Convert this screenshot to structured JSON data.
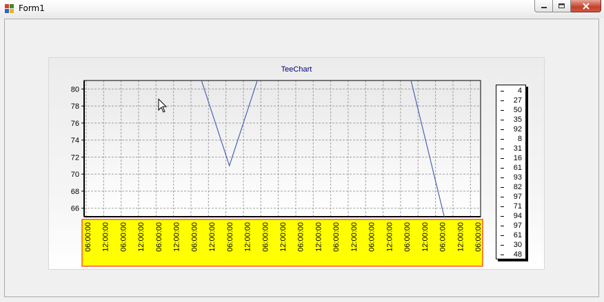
{
  "window": {
    "title": "Form1",
    "icon": "winforms-app-icon",
    "buttons": [
      "minimize-icon",
      "maximize-icon",
      "close-icon"
    ]
  },
  "colors": {
    "series_line": "#4a63b5",
    "x_label_background": "#ffff00",
    "x_label_border": "#ff0000",
    "title_color": "#000080"
  },
  "chart_data": {
    "type": "line",
    "title": "TeeChart",
    "ylim": [
      65,
      81
    ],
    "yticks": [
      66,
      68,
      70,
      72,
      74,
      76,
      78,
      80
    ],
    "x_tick_labels": [
      "06:00:00",
      "12:00:00",
      "06:00:00",
      "12:00:00",
      "06:00:00",
      "12:00:00",
      "06:00:00",
      "12:00:00",
      "06:00:00",
      "12:00:00",
      "06:00:00",
      "12:00:00",
      "06:00:00",
      "12:00:00",
      "06:00:00",
      "12:00:00",
      "06:00:00",
      "12:00:00",
      "06:00:00",
      "12:00:00",
      "06:00:00",
      "12:00:00",
      "06:00:00"
    ],
    "grid": true,
    "legend_position": "right",
    "series": [
      {
        "values": [
          4,
          27,
          50,
          35,
          92,
          8,
          31,
          16,
          61,
          93,
          82,
          97,
          71,
          94,
          97,
          61,
          30,
          48
        ]
      }
    ],
    "visible_segments": [
      {
        "x": [
          6.6,
          8.2,
          9.8
        ],
        "y": [
          81,
          71,
          81
        ]
      },
      {
        "x": [
          18.6,
          20.5
        ],
        "y": [
          81,
          65
        ]
      }
    ],
    "legend_entries": [
      "4",
      "27",
      "50",
      "35",
      "92",
      "8",
      "31",
      "16",
      "61",
      "93",
      "82",
      "97",
      "71",
      "94",
      "97",
      "61",
      "30",
      "48"
    ]
  }
}
